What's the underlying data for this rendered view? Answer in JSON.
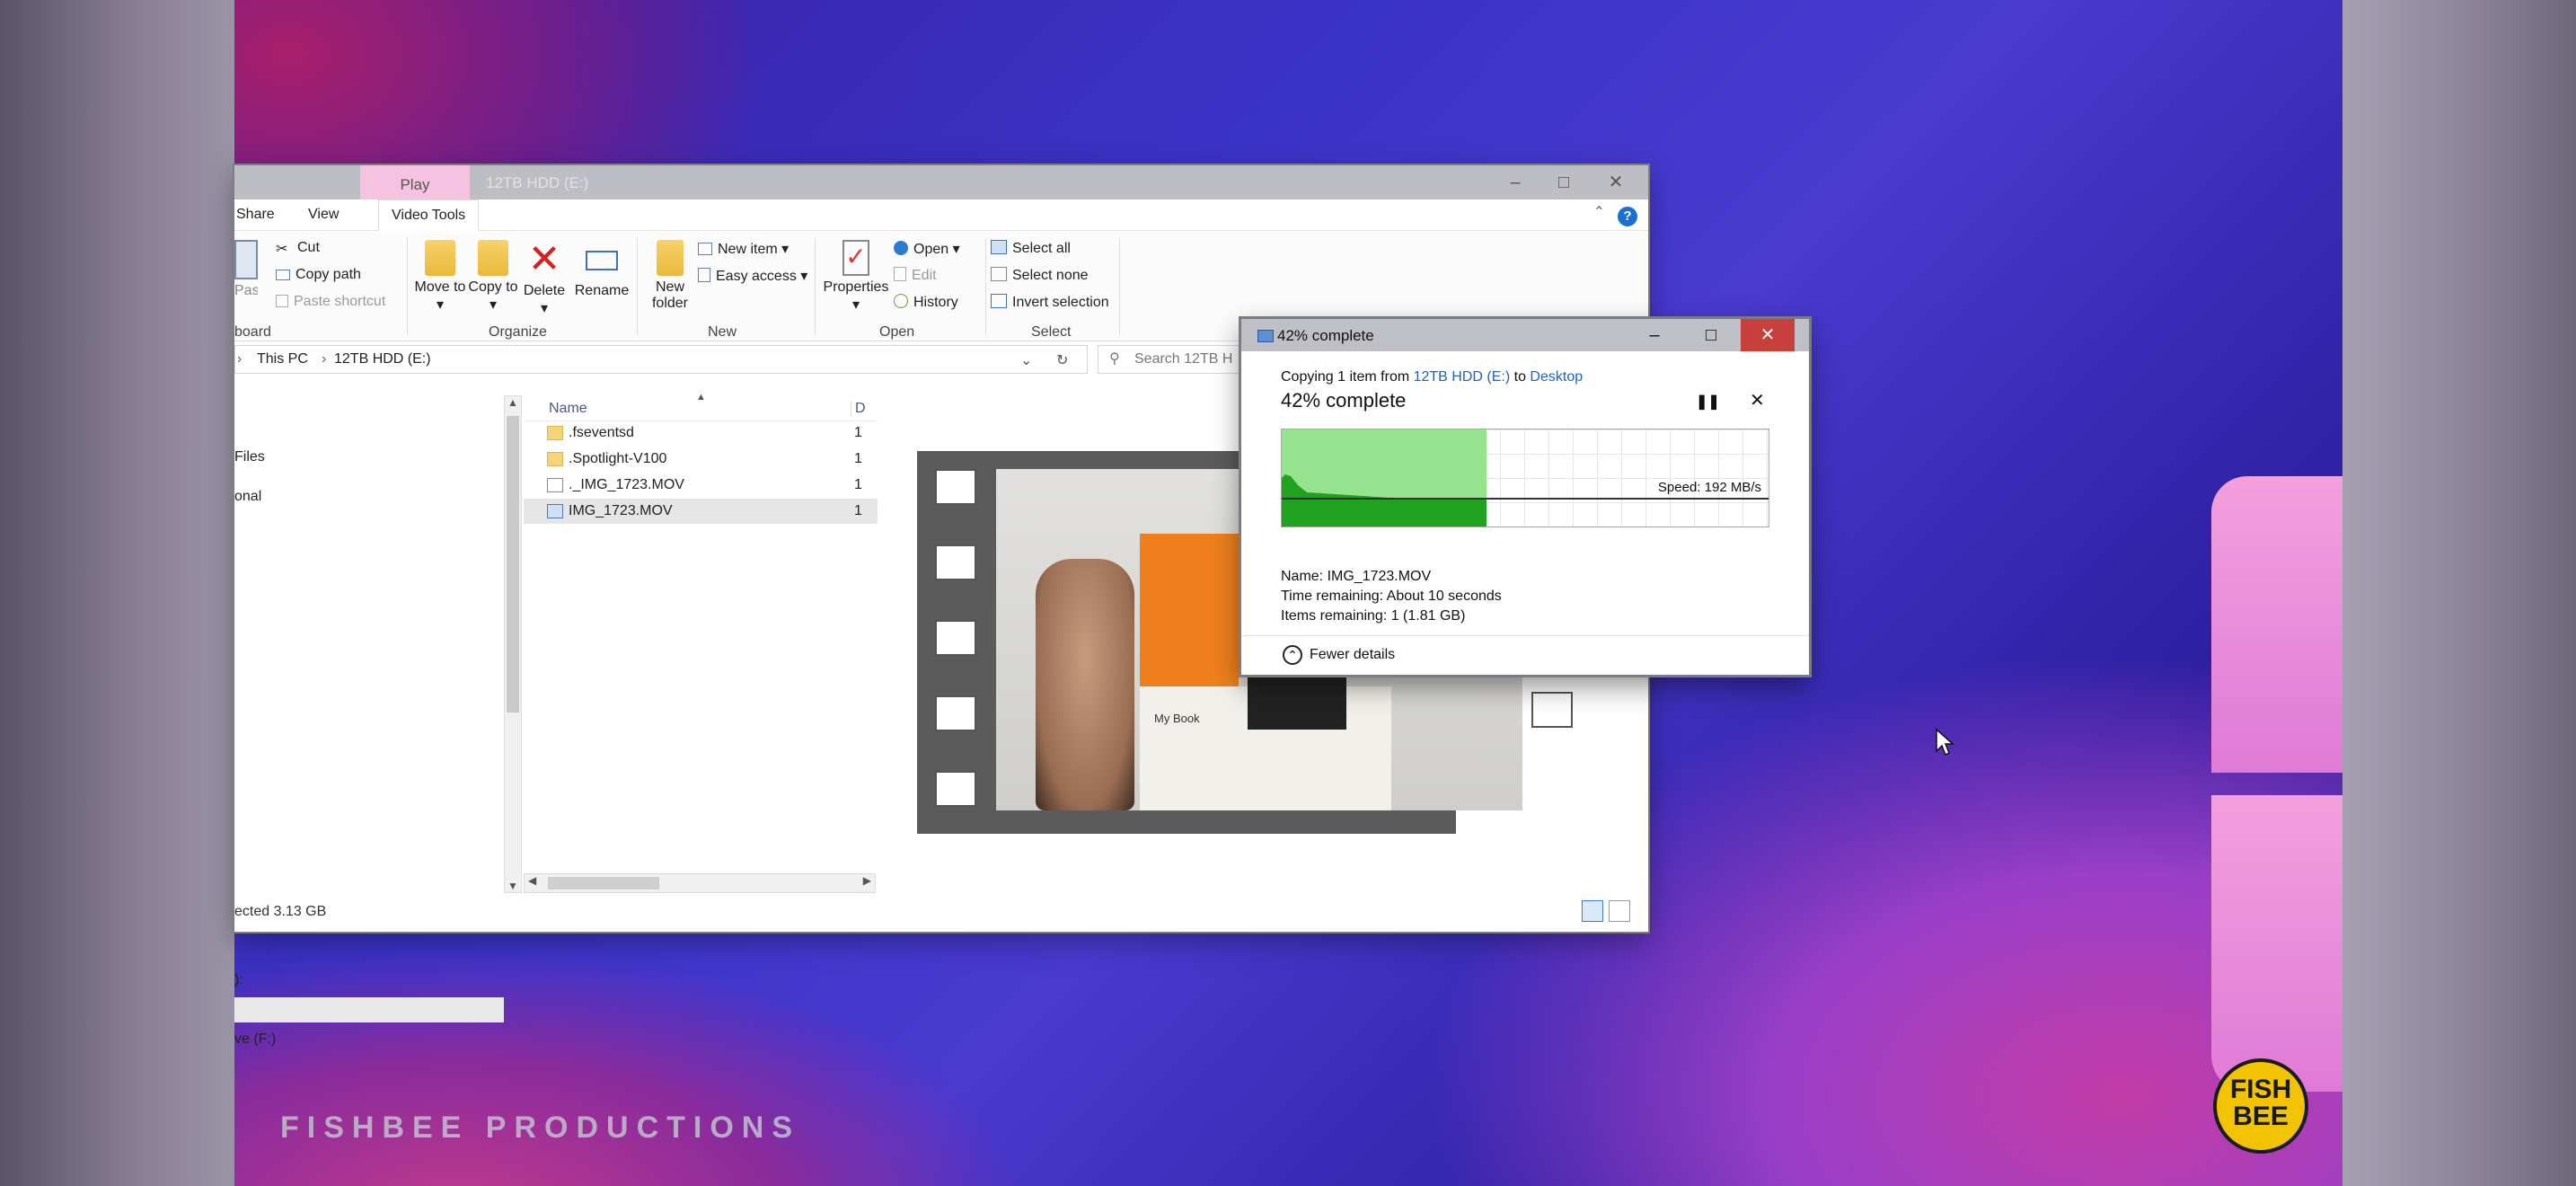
{
  "explorer": {
    "title": "12TB HDD (E:)",
    "contextual_tab": "Play",
    "tabs": [
      "Share",
      "View",
      "Video Tools"
    ],
    "ribbon": {
      "clipboard": {
        "paste": "Paste",
        "cut": "Cut",
        "copy_path": "Copy path",
        "paste_shortcut": "Paste shortcut",
        "group": "board"
      },
      "organize": {
        "move_to": "Move to",
        "copy_to": "Copy to",
        "delete": "Delete",
        "rename": "Rename",
        "group": "Organize"
      },
      "new": {
        "new_folder": "New folder",
        "new_item": "New item",
        "easy_access": "Easy access",
        "group": "New"
      },
      "open": {
        "properties": "Properties",
        "open": "Open",
        "edit": "Edit",
        "history": "History",
        "group": "Open"
      },
      "select": {
        "select_all": "Select all",
        "select_none": "Select none",
        "invert_selection": "Invert selection",
        "group": "Select"
      }
    },
    "address": {
      "crumbs": [
        "This PC",
        "12TB HDD (E:)"
      ]
    },
    "search_placeholder": "Search 12TB H",
    "nav_items": [
      "Files",
      "onal",
      "):",
      "ve (F:)"
    ],
    "column_name": "Name",
    "column_date": "D",
    "files": [
      {
        "name": ".fseventsd",
        "type": "folder",
        "d": "1"
      },
      {
        "name": ".Spotlight-V100",
        "type": "folder",
        "d": "1"
      },
      {
        "name": "._IMG_1723.MOV",
        "type": "file",
        "d": "1"
      },
      {
        "name": "IMG_1723.MOV",
        "type": "movie",
        "d": "1",
        "selected": true
      }
    ],
    "status": "ected  3.13 GB",
    "preview": {
      "box_text": "My Book"
    }
  },
  "copy_dialog": {
    "title": "42% complete",
    "line_prefix": "Copying 1 item from ",
    "source": "12TB HDD (E:)",
    "line_mid": " to ",
    "destination": "Desktop",
    "percent_label": "42% complete",
    "progress": 0.42,
    "speed": "Speed: 192 MB/s",
    "name": "Name:  IMG_1723.MOV",
    "time_remaining": "Time remaining:  About 10 seconds",
    "items_remaining": "Items remaining:  1 (1.81 GB)",
    "fewer_details": "Fewer details"
  },
  "branding": {
    "watermark": "FISHBEE PRODUCTIONS",
    "badge_line1": "FISH",
    "badge_line2": "BEE"
  }
}
